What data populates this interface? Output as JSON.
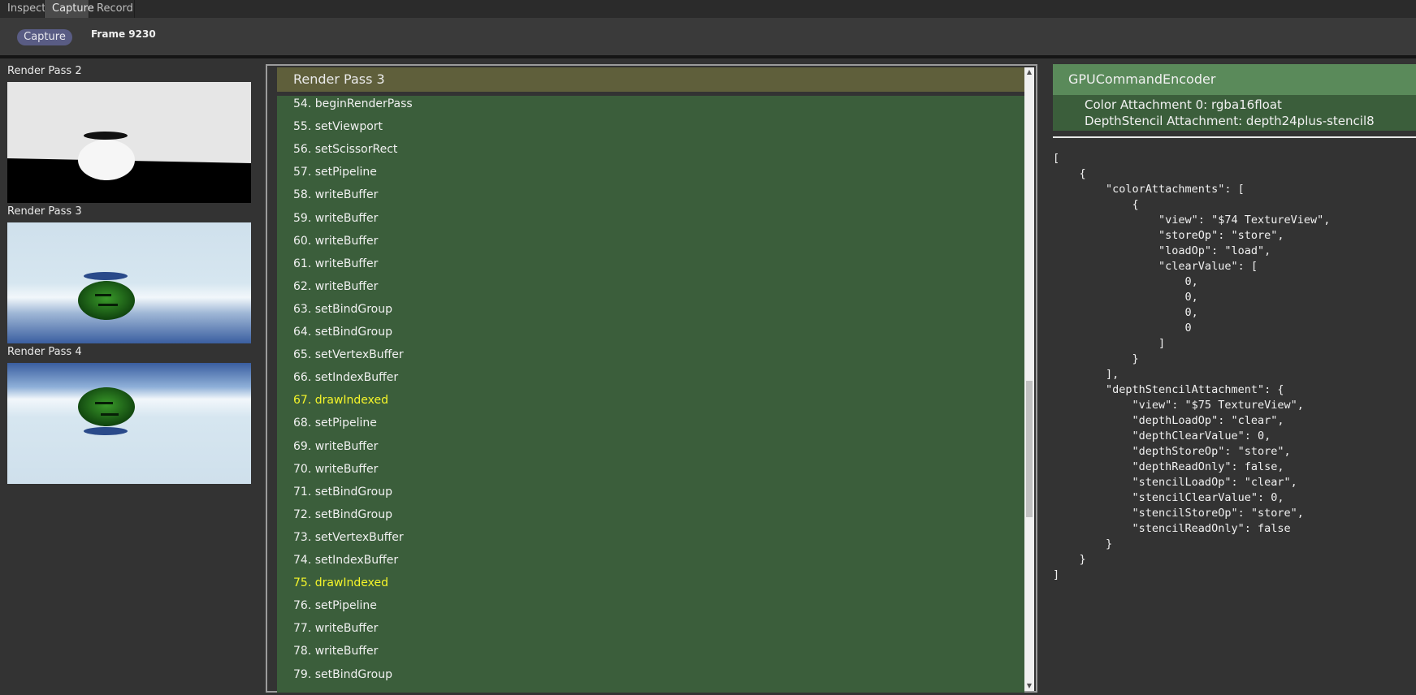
{
  "tabs": [
    {
      "label": "Inspect",
      "active": false
    },
    {
      "label": "Capture",
      "active": true
    },
    {
      "label": "Record",
      "active": false
    }
  ],
  "toolbar": {
    "capture_label": "Capture",
    "frame_label": "Frame 9230"
  },
  "thumbnails": [
    {
      "title": "Render Pass 2"
    },
    {
      "title": "Render Pass 3"
    },
    {
      "title": "Render Pass 4"
    }
  ],
  "command_panel": {
    "header": "Render Pass 3",
    "commands": [
      {
        "label": "54. beginRenderPass",
        "is_draw": false
      },
      {
        "label": "55. setViewport",
        "is_draw": false
      },
      {
        "label": "56. setScissorRect",
        "is_draw": false
      },
      {
        "label": "57. setPipeline",
        "is_draw": false
      },
      {
        "label": "58. writeBuffer",
        "is_draw": false
      },
      {
        "label": "59. writeBuffer",
        "is_draw": false
      },
      {
        "label": "60. writeBuffer",
        "is_draw": false
      },
      {
        "label": "61. writeBuffer",
        "is_draw": false
      },
      {
        "label": "62. writeBuffer",
        "is_draw": false
      },
      {
        "label": "63. setBindGroup",
        "is_draw": false
      },
      {
        "label": "64. setBindGroup",
        "is_draw": false
      },
      {
        "label": "65. setVertexBuffer",
        "is_draw": false
      },
      {
        "label": "66. setIndexBuffer",
        "is_draw": false
      },
      {
        "label": "67. drawIndexed",
        "is_draw": true
      },
      {
        "label": "68. setPipeline",
        "is_draw": false
      },
      {
        "label": "69. writeBuffer",
        "is_draw": false
      },
      {
        "label": "70. writeBuffer",
        "is_draw": false
      },
      {
        "label": "71. setBindGroup",
        "is_draw": false
      },
      {
        "label": "72. setBindGroup",
        "is_draw": false
      },
      {
        "label": "73. setVertexBuffer",
        "is_draw": false
      },
      {
        "label": "74. setIndexBuffer",
        "is_draw": false
      },
      {
        "label": "75. drawIndexed",
        "is_draw": true
      },
      {
        "label": "76. setPipeline",
        "is_draw": false
      },
      {
        "label": "77. writeBuffer",
        "is_draw": false
      },
      {
        "label": "78. writeBuffer",
        "is_draw": false
      },
      {
        "label": "79. setBindGroup",
        "is_draw": false
      }
    ]
  },
  "encoder": {
    "title": "GPUCommandEncoder",
    "color_attachment": "Color Attachment 0: rgba16float",
    "depth_attachment": "DepthStencil Attachment: depth24plus-stencil8",
    "json_text": "[\n    {\n        \"colorAttachments\": [\n            {\n                \"view\": \"$74 TextureView\",\n                \"storeOp\": \"store\",\n                \"loadOp\": \"load\",\n                \"clearValue\": [\n                    0,\n                    0,\n                    0,\n                    0\n                ]\n            }\n        ],\n        \"depthStencilAttachment\": {\n            \"view\": \"$75 TextureView\",\n            \"depthLoadOp\": \"clear\",\n            \"depthClearValue\": 0,\n            \"depthStoreOp\": \"store\",\n            \"depthReadOnly\": false,\n            \"stencilLoadOp\": \"clear\",\n            \"stencilClearValue\": 0,\n            \"stencilStoreOp\": \"store\",\n            \"stencilReadOnly\": false\n        }\n    }\n]"
  },
  "colors": {
    "command_bg": "#3b5e3b",
    "header_bg": "#5f5f3b",
    "draw_color": "#f5f52a",
    "encoder_header_bg": "#5a8a5a",
    "capture_button_bg": "#595c84"
  }
}
